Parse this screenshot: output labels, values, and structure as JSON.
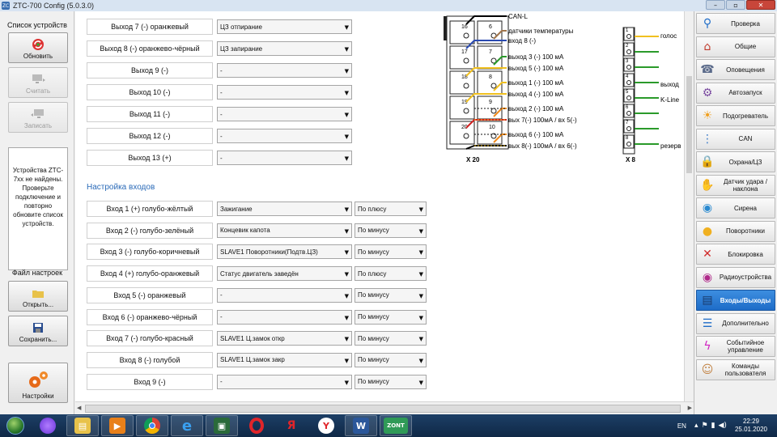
{
  "window": {
    "title": "ZTC-700 Config  (5.0.3.0)",
    "min": "–",
    "max": "▫",
    "close": "✕"
  },
  "left": {
    "devices_label": "Список устройств",
    "refresh": "Обновить",
    "read": "Считать",
    "write": "Записать",
    "devices_message": "Устройства ZTC-7xx не найдены. Проверьте подключение и повторно обновите список устройств.",
    "settings_file_label": "Файл настроек",
    "open": "Открыть...",
    "save": "Сохранить...",
    "settings": "Настройки"
  },
  "outputs": [
    {
      "label": "Выход 7 (-) оранжевый",
      "value": "ЦЗ отпирание"
    },
    {
      "label": "Выход 8 (-) оранжево-чёрный",
      "value": "ЦЗ запирание"
    },
    {
      "label": "Выход 9 (-)",
      "value": "-"
    },
    {
      "label": "Выход 10 (-)",
      "value": "-"
    },
    {
      "label": "Выход 11 (-)",
      "value": "-"
    },
    {
      "label": "Выход 12 (-)",
      "value": "-"
    },
    {
      "label": "Выход 13 (+)",
      "value": "-"
    }
  ],
  "inputs_title": "Настройка входов",
  "inputs": [
    {
      "label": "Вход 1 (+) голубо-жёлтый",
      "value": "Зажигание",
      "polarity": "По плюсу"
    },
    {
      "label": "Вход 2 (-) голубо-зелёный",
      "value": "Концевик капота",
      "polarity": "По минусу"
    },
    {
      "label": "Вход 3 (-) голубо-коричневый",
      "value": "SLAVE1 Поворотники(Подтв.ЦЗ)",
      "polarity": "По минусу"
    },
    {
      "label": "Вход 4 (+) голубо-оранжевый",
      "value": "Статус двигатель заведён",
      "polarity": "По плюсу"
    },
    {
      "label": "Вход 5 (-) оранжевый",
      "value": "-",
      "polarity": "По минусу"
    },
    {
      "label": "Вход 6 (-) оранжево-чёрный",
      "value": "-",
      "polarity": "По минусу"
    },
    {
      "label": "Вход 7 (-) голубо-красный",
      "value": "SLAVE1 Ц.замок откр",
      "polarity": "По минусу"
    },
    {
      "label": "Вход 8 (-) голубой",
      "value": "SLAVE1 Ц.замок закр",
      "polarity": "По минусу"
    },
    {
      "label": "Вход 9 (-)",
      "value": "-",
      "polarity": "По минусу"
    }
  ],
  "diagram": {
    "x20_label": "X 20",
    "x8_label": "X 8",
    "pins_left": [
      "16",
      "17",
      "18",
      "19",
      "20"
    ],
    "pins_right": [
      "6",
      "7",
      "8",
      "9",
      "10"
    ],
    "x8_pins": [
      "1",
      "2",
      "3",
      "4",
      "5",
      "6",
      "7",
      "8"
    ],
    "wire_labels": [
      "CAN-L",
      "датчики температуры",
      "вход 8 (-)",
      "выход 3 (-) 100 мА",
      "выход 5 (-) 100 мА",
      "выход 1 (-) 100 мА",
      "выход 4 (-) 100 мА",
      "выход 2 (-) 100 мА",
      "вых 7(-) 100мА / вх 5(-)",
      "выход 6 (-) 100 мА",
      "вых 8(-) 100мА / вх 6(-)"
    ],
    "x8_labels": [
      "голос",
      "выход",
      "K-Line",
      "резерв"
    ]
  },
  "nav": [
    {
      "label": "Проверка",
      "icon": "magnifier-icon"
    },
    {
      "label": "Общие",
      "icon": "house-icon"
    },
    {
      "label": "Оповещения",
      "icon": "phone-icon"
    },
    {
      "label": "Автозапуск",
      "icon": "engine-icon"
    },
    {
      "label": "Подогреватель",
      "icon": "sun-icon"
    },
    {
      "label": "CAN",
      "icon": "network-icon"
    },
    {
      "label": "Охрана/ЦЗ",
      "icon": "lock-icon"
    },
    {
      "label": "Датчик удара / наклона",
      "icon": "hand-icon"
    },
    {
      "label": "Сирена",
      "icon": "bell-icon"
    },
    {
      "label": "Поворотники",
      "icon": "bulb-icon"
    },
    {
      "label": "Блокировка",
      "icon": "block-icon"
    },
    {
      "label": "Радиоустройства",
      "icon": "radio-icon"
    },
    {
      "label": "Входы/Выходы",
      "icon": "ports-icon"
    },
    {
      "label": "Дополнительно",
      "icon": "list-icon"
    },
    {
      "label": "Событийное управление",
      "icon": "lightning-icon"
    },
    {
      "label": "Команды пользователя",
      "icon": "user-icon"
    }
  ],
  "taskbar": {
    "lang": "EN",
    "time": "22:29",
    "date": "25.01.2020",
    "apps": [
      "explorer",
      "media-player",
      "chrome",
      "ie",
      "terminal",
      "opera",
      "yandex",
      "yandex-browser",
      "word",
      "zont"
    ]
  },
  "colors": {
    "accent": "#1e6cc8",
    "section_title": "#2a6ab8"
  }
}
